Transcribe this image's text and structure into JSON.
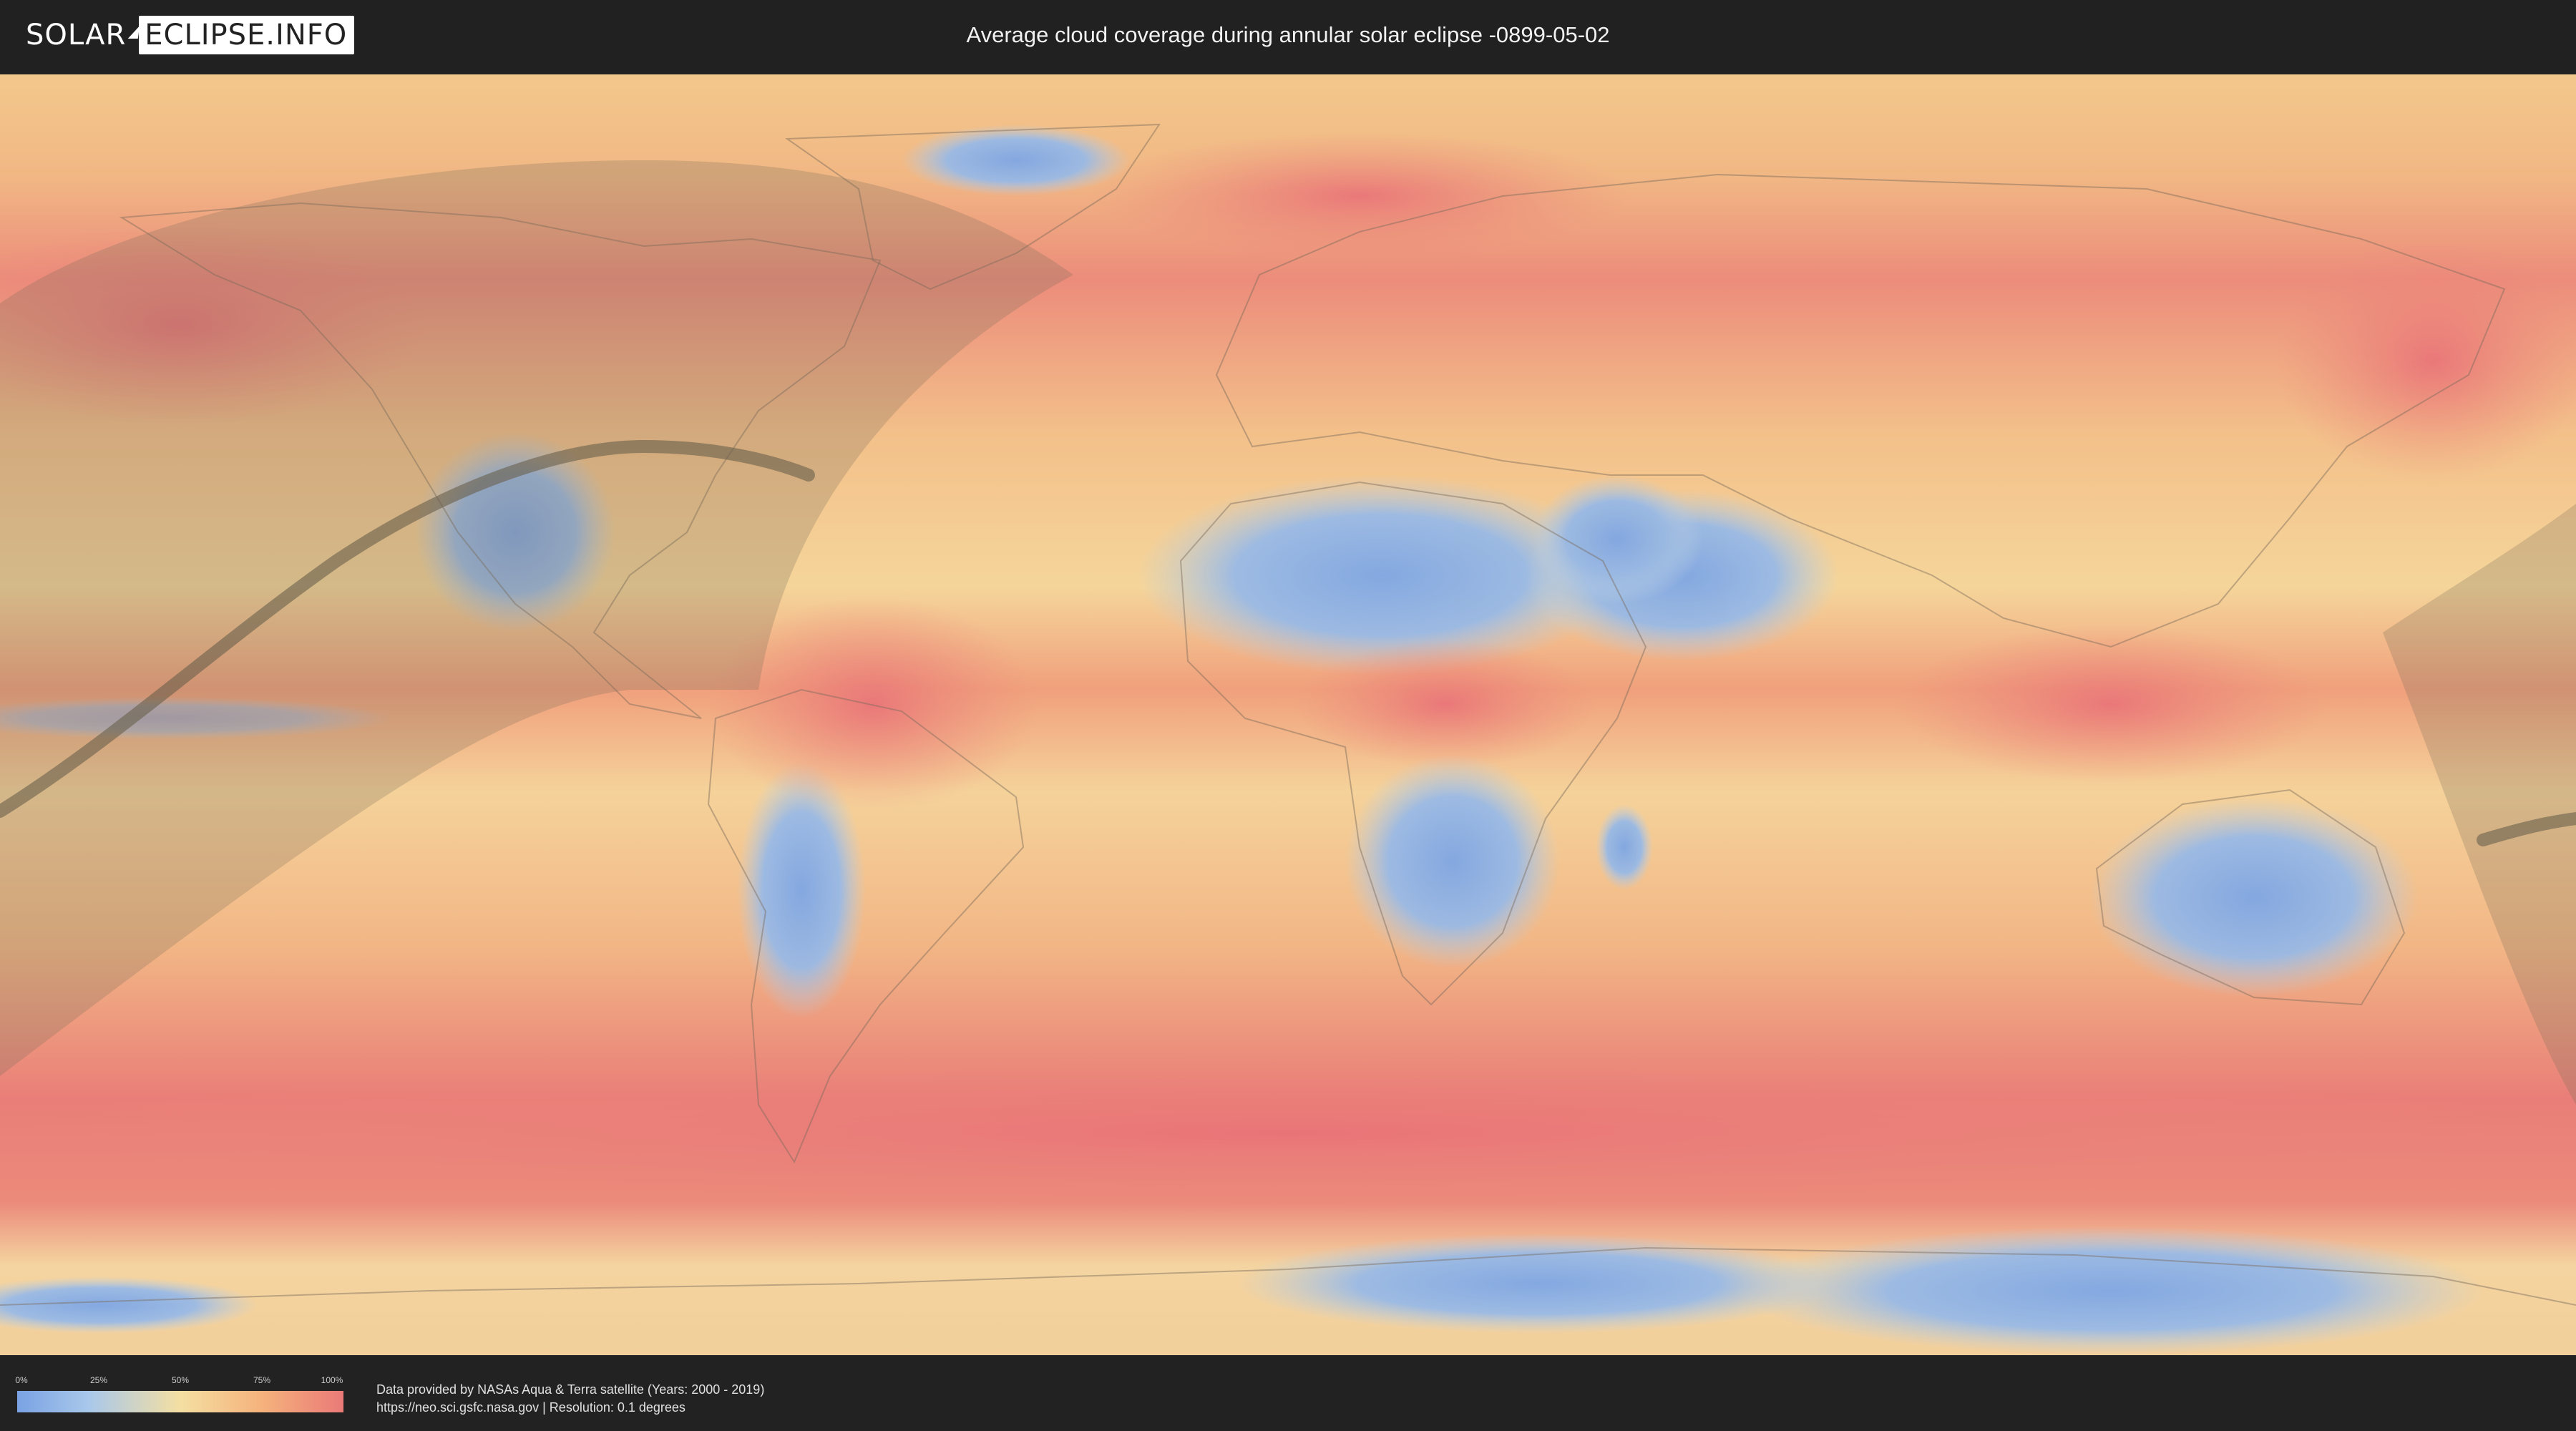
{
  "header": {
    "logo_left": "SOLAR",
    "logo_right": "ECLIPSE.INFO",
    "title": "Average cloud coverage during annular solar eclipse -0899-05-02"
  },
  "legend": {
    "ticks": [
      "0%",
      "25%",
      "50%",
      "75%",
      "100%"
    ],
    "colors": [
      "#7aa2e4",
      "#a9c8ea",
      "#f4dfa2",
      "#f5b27c",
      "#ea7a78"
    ]
  },
  "footer": {
    "credit_line_1": "Data provided by NASAs Aqua & Terra satellite (Years: 2000 - 2019)",
    "credit_line_2": "https://neo.sci.gsfc.nasa.gov | Resolution: 0.1 degrees"
  },
  "map": {
    "projection": "equirectangular world map",
    "colors": {
      "high_cloud": "#ea7a78",
      "mid_cloud": "#f5c98c",
      "low_cloud": "#7aa2e4",
      "shadow_path": "rgba(110,100,80,0.55)",
      "eclipse_region": "rgba(120,110,90,0.28)"
    }
  }
}
